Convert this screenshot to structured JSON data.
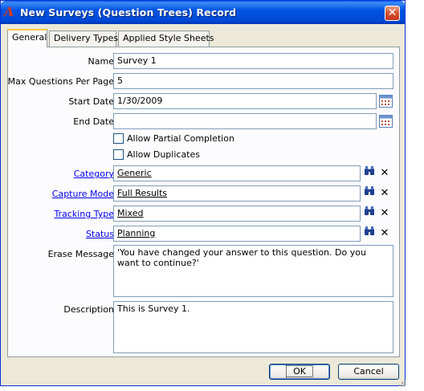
{
  "window": {
    "title": "New Surveys (Question Trees) Record"
  },
  "tabs": [
    {
      "label": "General",
      "active": true
    },
    {
      "label": "Delivery Types",
      "active": false
    },
    {
      "label": "Applied Style Sheets",
      "active": false
    }
  ],
  "form": {
    "name": {
      "label": "Name",
      "value": "Survey 1"
    },
    "max_questions": {
      "label": "Max Questions Per Page",
      "value": "5"
    },
    "start_date": {
      "label": "Start Date",
      "value": "1/30/2009"
    },
    "end_date": {
      "label": "End Date",
      "value": ""
    },
    "allow_partial": {
      "label": "Allow Partial Completion",
      "checked": false
    },
    "allow_duplicates": {
      "label": "Allow Duplicates",
      "checked": false
    },
    "category": {
      "label": "Category",
      "value": "Generic"
    },
    "capture_mode": {
      "label": "Capture Mode",
      "value": "Full Results"
    },
    "tracking_type": {
      "label": "Tracking Type",
      "value": "Mixed"
    },
    "status": {
      "label": "Status",
      "value": "Planning"
    },
    "erase_message": {
      "label": "Erase Message",
      "value": "'You have changed your answer to this question. Do you want to continue?'"
    },
    "description": {
      "label": "Description",
      "value": "This is Survey 1."
    }
  },
  "buttons": {
    "ok": "OK",
    "cancel": "Cancel"
  },
  "colors": {
    "titlebar": "#0054e3",
    "link": "#0000ee",
    "field_border": "#7f9db9"
  },
  "icons": {
    "app": "app-logo-icon",
    "close": "close-icon",
    "calendar": "calendar-icon",
    "lookup": "binoculars-icon",
    "clear": "clear-x-icon"
  }
}
